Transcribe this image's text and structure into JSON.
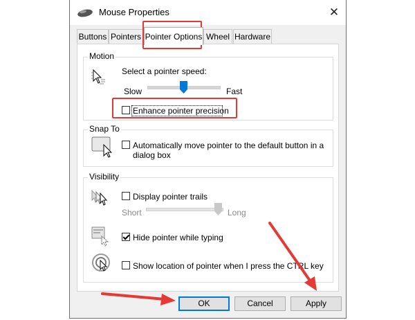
{
  "window": {
    "title": "Mouse Properties",
    "close_glyph": "✕"
  },
  "tabs": [
    {
      "label": "Buttons"
    },
    {
      "label": "Pointers"
    },
    {
      "label": "Pointer Options"
    },
    {
      "label": "Wheel"
    },
    {
      "label": "Hardware"
    }
  ],
  "motion": {
    "group_label": "Motion",
    "speed_label": "Select a pointer speed:",
    "slow_label": "Slow",
    "fast_label": "Fast",
    "speed_level": 0.5,
    "precision_label": "Enhance pointer precision",
    "precision_checked": false,
    "icon": "pointer-speed-icon"
  },
  "snap_to": {
    "group_label": "Snap To",
    "label_line1": "Automatically move pointer to the default button in a",
    "label_line2": "dialog box",
    "checked": false,
    "icon": "snap-to-icon"
  },
  "visibility": {
    "group_label": "Visibility",
    "trails_label": "Display pointer trails",
    "trails_checked": false,
    "short_label": "Short",
    "long_label": "Long",
    "trails_level": 1.0,
    "hide_label": "Hide pointer while typing",
    "hide_checked": true,
    "ctrl_label": "Show location of pointer when I press the CTRL key",
    "ctrl_checked": false,
    "icons": [
      "pointer-trails-icon",
      "hide-pointer-icon",
      "ctrl-locate-icon"
    ]
  },
  "buttons": {
    "ok": "OK",
    "cancel": "Cancel",
    "apply": "Apply"
  },
  "colors": {
    "highlight": "#e53935",
    "accent": "#0078d7",
    "window_bg": "#f0f0f0"
  }
}
